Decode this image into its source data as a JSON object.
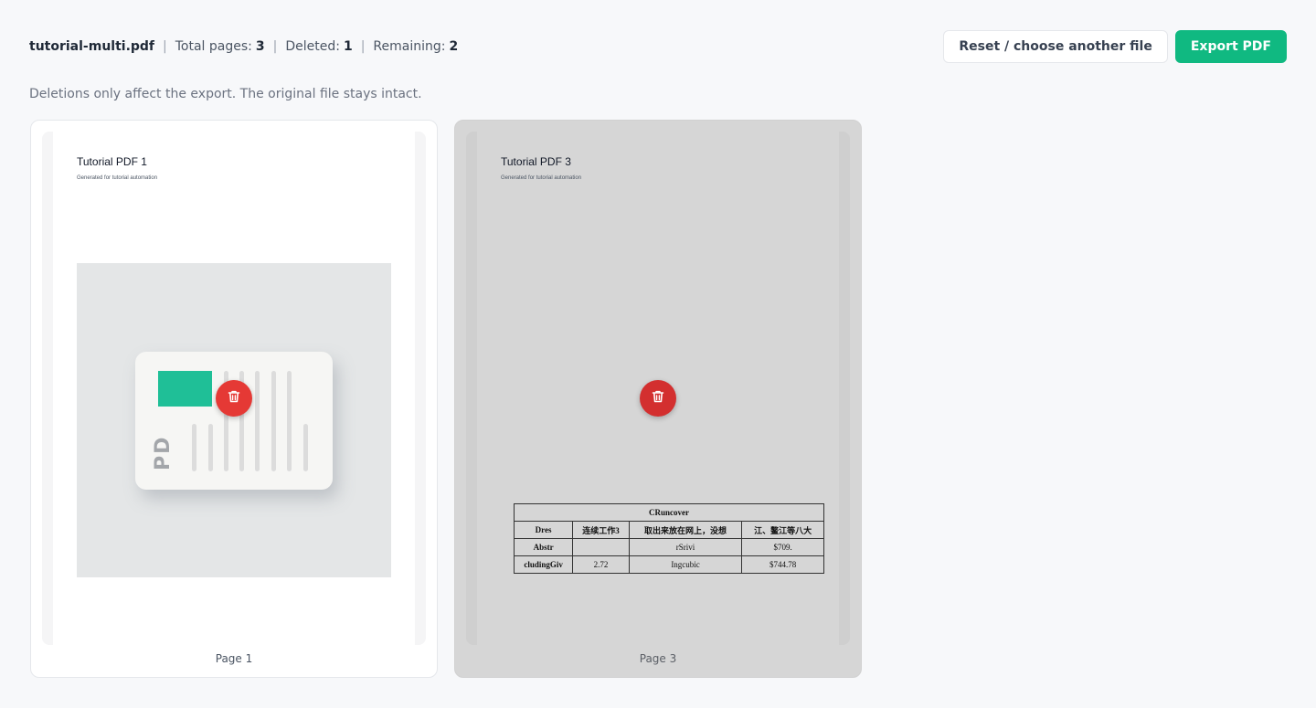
{
  "header": {
    "filename": "tutorial-multi.pdf",
    "separator": "|",
    "total_label": "Total pages:",
    "total_value": "3",
    "deleted_label": "Deleted:",
    "deleted_value": "1",
    "remaining_label": "Remaining:",
    "remaining_value": "2"
  },
  "actions": {
    "reset_label": "Reset / choose another file",
    "export_label": "Export PDF"
  },
  "hint": "Deletions only affect the export. The original file stays intact.",
  "pages": [
    {
      "title": "Tutorial PDF 1",
      "subtitle": "Generated for tutorial automation",
      "label": "Page 1",
      "state": "kept",
      "image_text": "PD",
      "delete_icon": "trash-icon"
    },
    {
      "title": "Tutorial PDF 3",
      "subtitle": "Generated for tutorial automation",
      "label": "Page 3",
      "state": "deleted",
      "delete_icon": "trash-icon",
      "table": {
        "caption": "CRuncover",
        "headers": [
          "Dres",
          "连续工作3",
          "取出来放在网上，没想",
          "江、鳌江等八大"
        ],
        "rows": [
          [
            "Abstr",
            "",
            "rSrivi",
            "$709."
          ],
          [
            "cludingGiv",
            "2.72",
            "Ingcubic",
            "$744.78"
          ]
        ]
      }
    }
  ],
  "colors": {
    "accent": "#10b981",
    "danger": "#e53935",
    "deleted_card": "#d6d6d6"
  }
}
